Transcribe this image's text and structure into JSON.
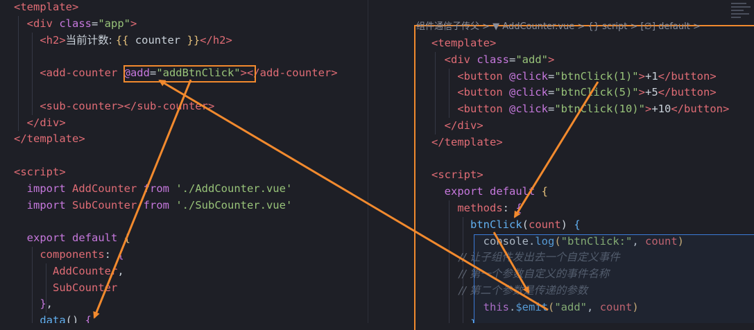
{
  "left_editor": {
    "lines": [
      [
        {
          "t": "<template>",
          "c": "tag"
        }
      ],
      [
        {
          "t": "  <div ",
          "c": "tag"
        },
        {
          "t": "class",
          "c": "attr"
        },
        {
          "t": "=",
          "c": "plain"
        },
        {
          "t": "\"app\"",
          "c": "str"
        },
        {
          "t": ">",
          "c": "tag"
        }
      ],
      [
        {
          "t": "    <h2>",
          "c": "tag"
        },
        {
          "t": "当前计数: ",
          "c": "plain cjk"
        },
        {
          "t": "{{",
          "c": "brace"
        },
        {
          "t": " counter ",
          "c": "plain"
        },
        {
          "t": "}}",
          "c": "brace"
        },
        {
          "t": "</h2>",
          "c": "tag"
        }
      ],
      [],
      [
        {
          "t": "    <add-counter ",
          "c": "tag"
        },
        {
          "t": "@add",
          "c": "attr"
        },
        {
          "t": "=",
          "c": "plain"
        },
        {
          "t": "\"addBtnClick\"",
          "c": "str"
        },
        {
          "t": "></add-counter>",
          "c": "tag"
        }
      ],
      [],
      [
        {
          "t": "    <sub-counter></sub-counter>",
          "c": "tag"
        }
      ],
      [
        {
          "t": "  </div>",
          "c": "tag"
        }
      ],
      [
        {
          "t": "</template>",
          "c": "tag"
        }
      ],
      [],
      [
        {
          "t": "<script>",
          "c": "tag"
        }
      ],
      [
        {
          "t": "  import ",
          "c": "kw"
        },
        {
          "t": "AddCounter ",
          "c": "tag"
        },
        {
          "t": "from ",
          "c": "kw"
        },
        {
          "t": "'./AddCounter.vue'",
          "c": "str"
        }
      ],
      [
        {
          "t": "  import ",
          "c": "kw"
        },
        {
          "t": "SubCounter ",
          "c": "tag"
        },
        {
          "t": "from ",
          "c": "kw"
        },
        {
          "t": "'./SubCounter.vue'",
          "c": "str"
        }
      ],
      [],
      [
        {
          "t": "  export ",
          "c": "kw"
        },
        {
          "t": "default ",
          "c": "kw"
        },
        {
          "t": "{",
          "c": "brace"
        }
      ],
      [
        {
          "t": "    components",
          "c": "tag"
        },
        {
          "t": ": ",
          "c": "plain"
        },
        {
          "t": "{",
          "c": "attr"
        }
      ],
      [
        {
          "t": "      AddCounter",
          "c": "tag"
        },
        {
          "t": ",",
          "c": "plain"
        }
      ],
      [
        {
          "t": "      SubCounter",
          "c": "tag"
        }
      ],
      [
        {
          "t": "    }",
          "c": "attr"
        },
        {
          "t": ",",
          "c": "plain"
        }
      ],
      [
        {
          "t": "    data",
          "c": "fn"
        },
        {
          "t": "() ",
          "c": "plain"
        },
        {
          "t": "{",
          "c": "attr"
        }
      ]
    ]
  },
  "right_editor": {
    "breadcrumb": "组件通信子传父 > ▼ AddCounter.vue > {} script > [∅] default > ",
    "lines": [
      [
        {
          "t": "<template>",
          "c": "tag"
        }
      ],
      [
        {
          "t": "  <div ",
          "c": "tag"
        },
        {
          "t": "class",
          "c": "attr"
        },
        {
          "t": "=",
          "c": "plain"
        },
        {
          "t": "\"add\"",
          "c": "str"
        },
        {
          "t": ">",
          "c": "tag"
        }
      ],
      [
        {
          "t": "    <button ",
          "c": "tag"
        },
        {
          "t": "@click",
          "c": "attr"
        },
        {
          "t": "=",
          "c": "plain"
        },
        {
          "t": "\"btnClick(1)\"",
          "c": "str"
        },
        {
          "t": ">",
          "c": "tag"
        },
        {
          "t": "+1",
          "c": "plain"
        },
        {
          "t": "</button>",
          "c": "tag"
        }
      ],
      [
        {
          "t": "    <button ",
          "c": "tag"
        },
        {
          "t": "@click",
          "c": "attr"
        },
        {
          "t": "=",
          "c": "plain"
        },
        {
          "t": "\"btnClick(5)\"",
          "c": "str"
        },
        {
          "t": ">",
          "c": "tag"
        },
        {
          "t": "+5",
          "c": "plain"
        },
        {
          "t": "</button>",
          "c": "tag"
        }
      ],
      [
        {
          "t": "    <button ",
          "c": "tag"
        },
        {
          "t": "@click",
          "c": "attr"
        },
        {
          "t": "=",
          "c": "plain"
        },
        {
          "t": "\"btnClick(10)\"",
          "c": "str"
        },
        {
          "t": ">",
          "c": "tag"
        },
        {
          "t": "+10",
          "c": "plain"
        },
        {
          "t": "</button>",
          "c": "tag"
        }
      ],
      [
        {
          "t": "  </div>",
          "c": "tag"
        }
      ],
      [
        {
          "t": "</template>",
          "c": "tag"
        }
      ],
      [],
      [
        {
          "t": "<script>",
          "c": "tag"
        }
      ],
      [
        {
          "t": "  export ",
          "c": "kw"
        },
        {
          "t": "default ",
          "c": "kw"
        },
        {
          "t": "{",
          "c": "brace"
        }
      ],
      [
        {
          "t": "    methods",
          "c": "tag"
        },
        {
          "t": ": ",
          "c": "plain"
        },
        {
          "t": "{",
          "c": "attr"
        }
      ],
      [
        {
          "t": "      btnClick",
          "c": "fn"
        },
        {
          "t": "(",
          "c": "plain"
        },
        {
          "t": "count",
          "c": "tag"
        },
        {
          "t": ") ",
          "c": "plain"
        },
        {
          "t": "{",
          "c": "fn"
        }
      ],
      [
        {
          "t": "        console",
          "c": "plain"
        },
        {
          "t": ".",
          "c": "plain"
        },
        {
          "t": "log",
          "c": "fn"
        },
        {
          "t": "(",
          "c": "brace"
        },
        {
          "t": "\"btnClick:\"",
          "c": "str"
        },
        {
          "t": ", ",
          "c": "plain"
        },
        {
          "t": "count",
          "c": "tag"
        },
        {
          "t": ")",
          "c": "brace"
        }
      ],
      [
        {
          "t": "        // 让子组件发出去一个自定义事件",
          "c": "comment cjk"
        }
      ],
      [
        {
          "t": "        // 第一个参数自定义的事件名称",
          "c": "comment cjk"
        }
      ],
      [
        {
          "t": "        // 第二个参数是传递的参数",
          "c": "comment cjk"
        }
      ],
      [
        {
          "t": "        this",
          "c": "kw"
        },
        {
          "t": ".",
          "c": "plain"
        },
        {
          "t": "$emit",
          "c": "fn"
        },
        {
          "t": "(",
          "c": "brace"
        },
        {
          "t": "\"add\"",
          "c": "str"
        },
        {
          "t": ", ",
          "c": "plain"
        },
        {
          "t": "count",
          "c": "tag"
        },
        {
          "t": ")",
          "c": "brace"
        }
      ],
      [
        {
          "t": "      }",
          "c": "fn"
        }
      ]
    ]
  },
  "annotation_color": "#f28a2e"
}
